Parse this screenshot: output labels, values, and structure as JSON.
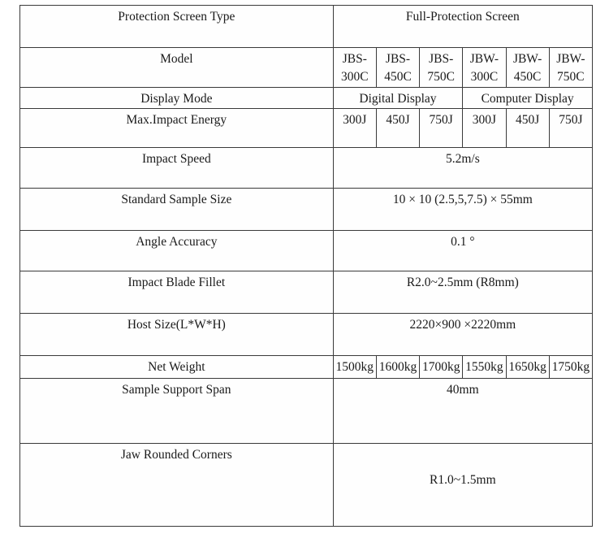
{
  "table": {
    "columns": 7,
    "rows": [
      {
        "id": "protection-screen-type",
        "label": "Protection Screen Type",
        "merged": true,
        "value": "Full-Protection Screen"
      },
      {
        "id": "model",
        "label": "Model",
        "merged": false,
        "values": [
          "JBS-300C",
          "JBS-450C",
          "JBS-750C",
          "JBW-300C",
          "JBW-450C",
          "JBW-750C"
        ]
      },
      {
        "id": "display-mode",
        "label": "Display Mode",
        "merged": false,
        "grouped": true,
        "groups": [
          {
            "value": "Digital Display",
            "span": 3
          },
          {
            "value": "Computer Display",
            "span": 3
          }
        ]
      },
      {
        "id": "max-impact-energy",
        "label": "Max.Impact Energy",
        "merged": false,
        "values": [
          "300J",
          "450J",
          "750J",
          "300J",
          "450J",
          "750J"
        ]
      },
      {
        "id": "impact-speed",
        "label": "Impact Speed",
        "merged": true,
        "value": "5.2m/s"
      },
      {
        "id": "standard-sample-size",
        "label": "Standard Sample Size",
        "merged": true,
        "value": "10 × 10 (2.5,5,7.5) × 55mm"
      },
      {
        "id": "angle-accuracy",
        "label": "Angle Accuracy",
        "merged": true,
        "value": "0.1 °"
      },
      {
        "id": "impact-blade-fillet",
        "label": "Impact Blade Fillet",
        "merged": true,
        "value": "R2.0~2.5mm (R8mm)"
      },
      {
        "id": "host-size",
        "label": "Host Size(L*W*H)",
        "merged": true,
        "value": "2220×900 ×2220mm"
      },
      {
        "id": "net-weight",
        "label": "Net Weight",
        "merged": false,
        "values": [
          "1500kg",
          "1600kg",
          "1700kg",
          "1550kg",
          "1650kg",
          "1750kg"
        ]
      },
      {
        "id": "sample-support-span",
        "label": "Sample Support Span",
        "merged": true,
        "value": "40mm"
      },
      {
        "id": "jaw-rounded-corners",
        "label": "Jaw Rounded Corners",
        "merged": true,
        "value": "R1.0~1.5mm"
      }
    ]
  }
}
